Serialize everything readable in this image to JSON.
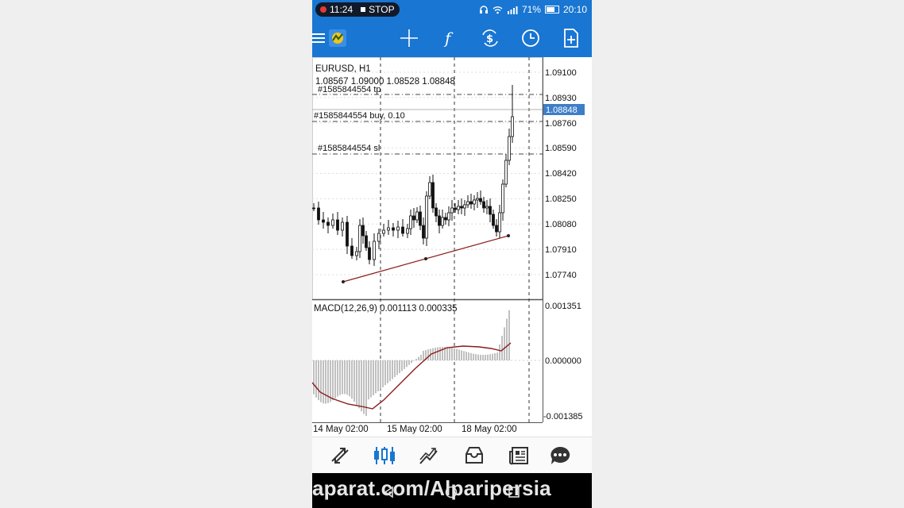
{
  "status_bar": {
    "record_time": "11:24",
    "stop_label": "STOP",
    "battery_level": "71%",
    "battery_fraction": 0.71,
    "clock": "20:10"
  },
  "toolbar": {
    "icons": [
      "menu-icon",
      "app-logo-icon",
      "crosshair-icon",
      "indicators-icon",
      "objects-icon",
      "timeframe-icon",
      "new-order-icon"
    ]
  },
  "chart": {
    "symbol": "EURUSD, H1",
    "ohlc": "1.08567 1.09000 1.08528 1.08848",
    "tp_label": "#1585844554 tp",
    "buy_label": "#1585844554 buy, 0.10",
    "sl_label": "#1585844554 sl",
    "price_ticks": [
      "1.09100",
      "1.08930",
      "1.08760",
      "1.08590",
      "1.08420",
      "1.08250",
      "1.08080",
      "1.07910",
      "1.07740"
    ],
    "current_price": "1.08848",
    "macd_label": "MACD(12,26,9) 0.001113 0.000335",
    "macd_ticks": [
      "0.001351",
      "0.000000",
      "-0.001385"
    ],
    "time_labels": [
      "14 May 02:00",
      "15 May 02:00",
      "18 May 02:00"
    ]
  },
  "colors": {
    "header_blue": "#1976d2",
    "price_badge": "#3d7ec8",
    "trendline": "#8b1a1a",
    "macd_signal": "#8b1a1a",
    "histogram": "#b0b0b0"
  },
  "bottom_nav": {
    "items": [
      "quotes-icon",
      "chart-icon",
      "trade-icon",
      "history-icon",
      "news-icon",
      "chat-icon"
    ],
    "active": "chart-icon"
  },
  "watermark": "aparat.com/Alparipersia"
}
